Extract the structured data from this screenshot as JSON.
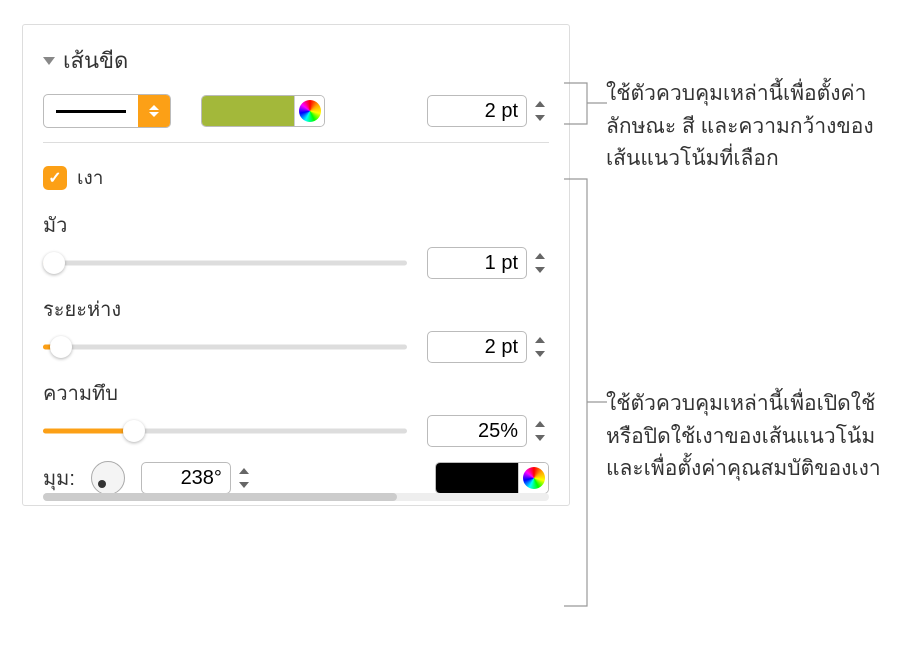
{
  "section": {
    "title": "เส้นขีด"
  },
  "stroke": {
    "width_value": "2 pt",
    "color": "#a3b83a"
  },
  "shadow": {
    "checkbox_label": "เงา",
    "checked": true,
    "blur": {
      "label": "มัว",
      "value": "1 pt",
      "percent": 3
    },
    "offset": {
      "label": "ระยะห่าง",
      "value": "2 pt",
      "percent": 5
    },
    "opacity": {
      "label": "ความทึบ",
      "value": "25%",
      "percent": 25
    },
    "angle": {
      "label": "มุม:",
      "value": "238°"
    },
    "color": "#000000"
  },
  "annotations": {
    "stroke": "ใช้ตัวควบคุมเหล่านี้เพื่อตั้งค่าลักษณะ สี และความกว้างของเส้นแนวโน้มที่เลือก",
    "shadow": "ใช้ตัวควบคุมเหล่านี้เพื่อเปิดใช้หรือปิดใช้เงาของเส้นแนวโน้มและเพื่อตั้งค่าคุณสมบัติของเงา"
  }
}
